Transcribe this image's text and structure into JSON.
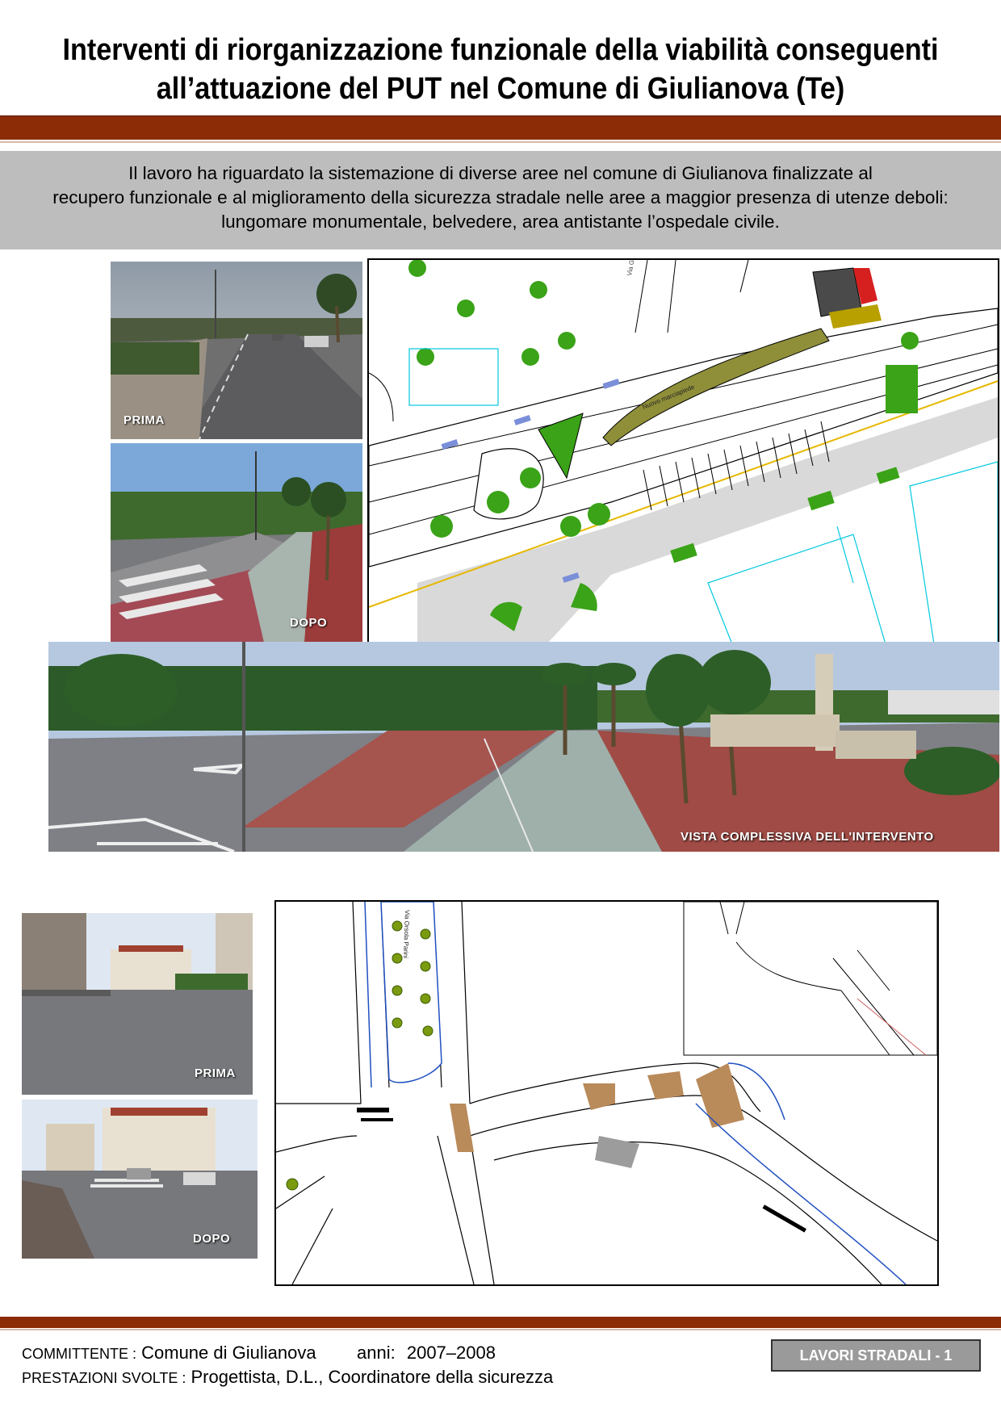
{
  "title": {
    "line1": "Interventi di riorganizzazione funzionale della viabilità conseguenti",
    "line2": "all’attuazione del PUT nel Comune di Giulianova (Te)"
  },
  "intro": {
    "line1": "Il lavoro ha riguardato la sistemazione di diverse aree nel comune di Giulianova finalizzate al",
    "line2": "recupero funzionale e al miglioramento della sicurezza stradale nelle aree a maggior presenza di utenze deboli:",
    "line3": "lungomare monumentale, belvedere, area antistante l’ospedale civile."
  },
  "photos": {
    "before_1": "PRIMA",
    "after_1": "DOPO",
    "overview": "VISTA COMPLESSIVA DELL'INTERVENTO",
    "before_2": "PRIMA",
    "after_2": "DOPO"
  },
  "plan_labels": {
    "street_1": "Via Garibaldi",
    "sidewalk": "Nuovo marciapiede",
    "street_2": "Via Orsola Parini"
  },
  "footer": {
    "client_label": "COMMITTENTE :",
    "client_value": "Comune di Giulianova",
    "years_label": "anni:",
    "years_value": "2007–2008",
    "services_label": "PRESTAZIONI SVOLTE :",
    "services_value": "Progettista, D.L., Coordinatore della sicurezza",
    "category": "LAVORI STRADALI - 1"
  },
  "colors": {
    "header_bar": "#8b2c07",
    "intro_band": "#bdbdbd",
    "plan_green": "#3aa317",
    "plan_cyan": "#00c8e0",
    "plan_brown": "#b98a5a"
  }
}
